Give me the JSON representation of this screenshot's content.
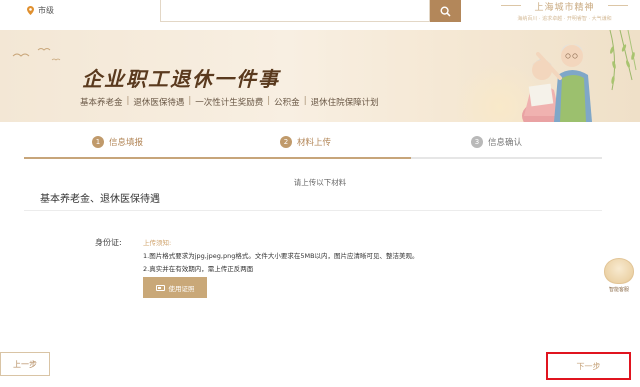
{
  "topbar": {
    "location": "市级",
    "brand_name": "上海城市精神",
    "brand_slogan": "海纳百川 · 追求卓越 · 开明睿智 · 大气谦和"
  },
  "banner": {
    "title": "企业职工退休一件事",
    "items": [
      "基本养老金",
      "退休医保待遇",
      "一次性计生奖励费",
      "公积金",
      "退休住院保障计划"
    ],
    "separator": "|"
  },
  "steps": [
    {
      "num": "1",
      "label": "信息填报",
      "state": "done"
    },
    {
      "num": "2",
      "label": "材料上传",
      "state": "done"
    },
    {
      "num": "3",
      "label": "信息确认",
      "state": "todo"
    }
  ],
  "progress_fraction": 0.67,
  "content": {
    "hint": "请上传以下材料",
    "section_title": "基本养老金、退休医保待遇",
    "id_label": "身份证:",
    "note_title": "上传须知:",
    "note_lines": [
      "1.图片格式要求为jpg,jpeg,png格式。文件大小要求在5MB以内，图片应清晰可见、整洁美观。",
      "2.真实并在有效期内，需上传正反两面"
    ],
    "upload_label": "使用证照"
  },
  "assistant": {
    "label": "智能客服"
  },
  "footer": {
    "prev": "上一步",
    "next": "下一步"
  },
  "colors": {
    "accent": "#c9a878",
    "highlight_border": "#e0141f"
  }
}
